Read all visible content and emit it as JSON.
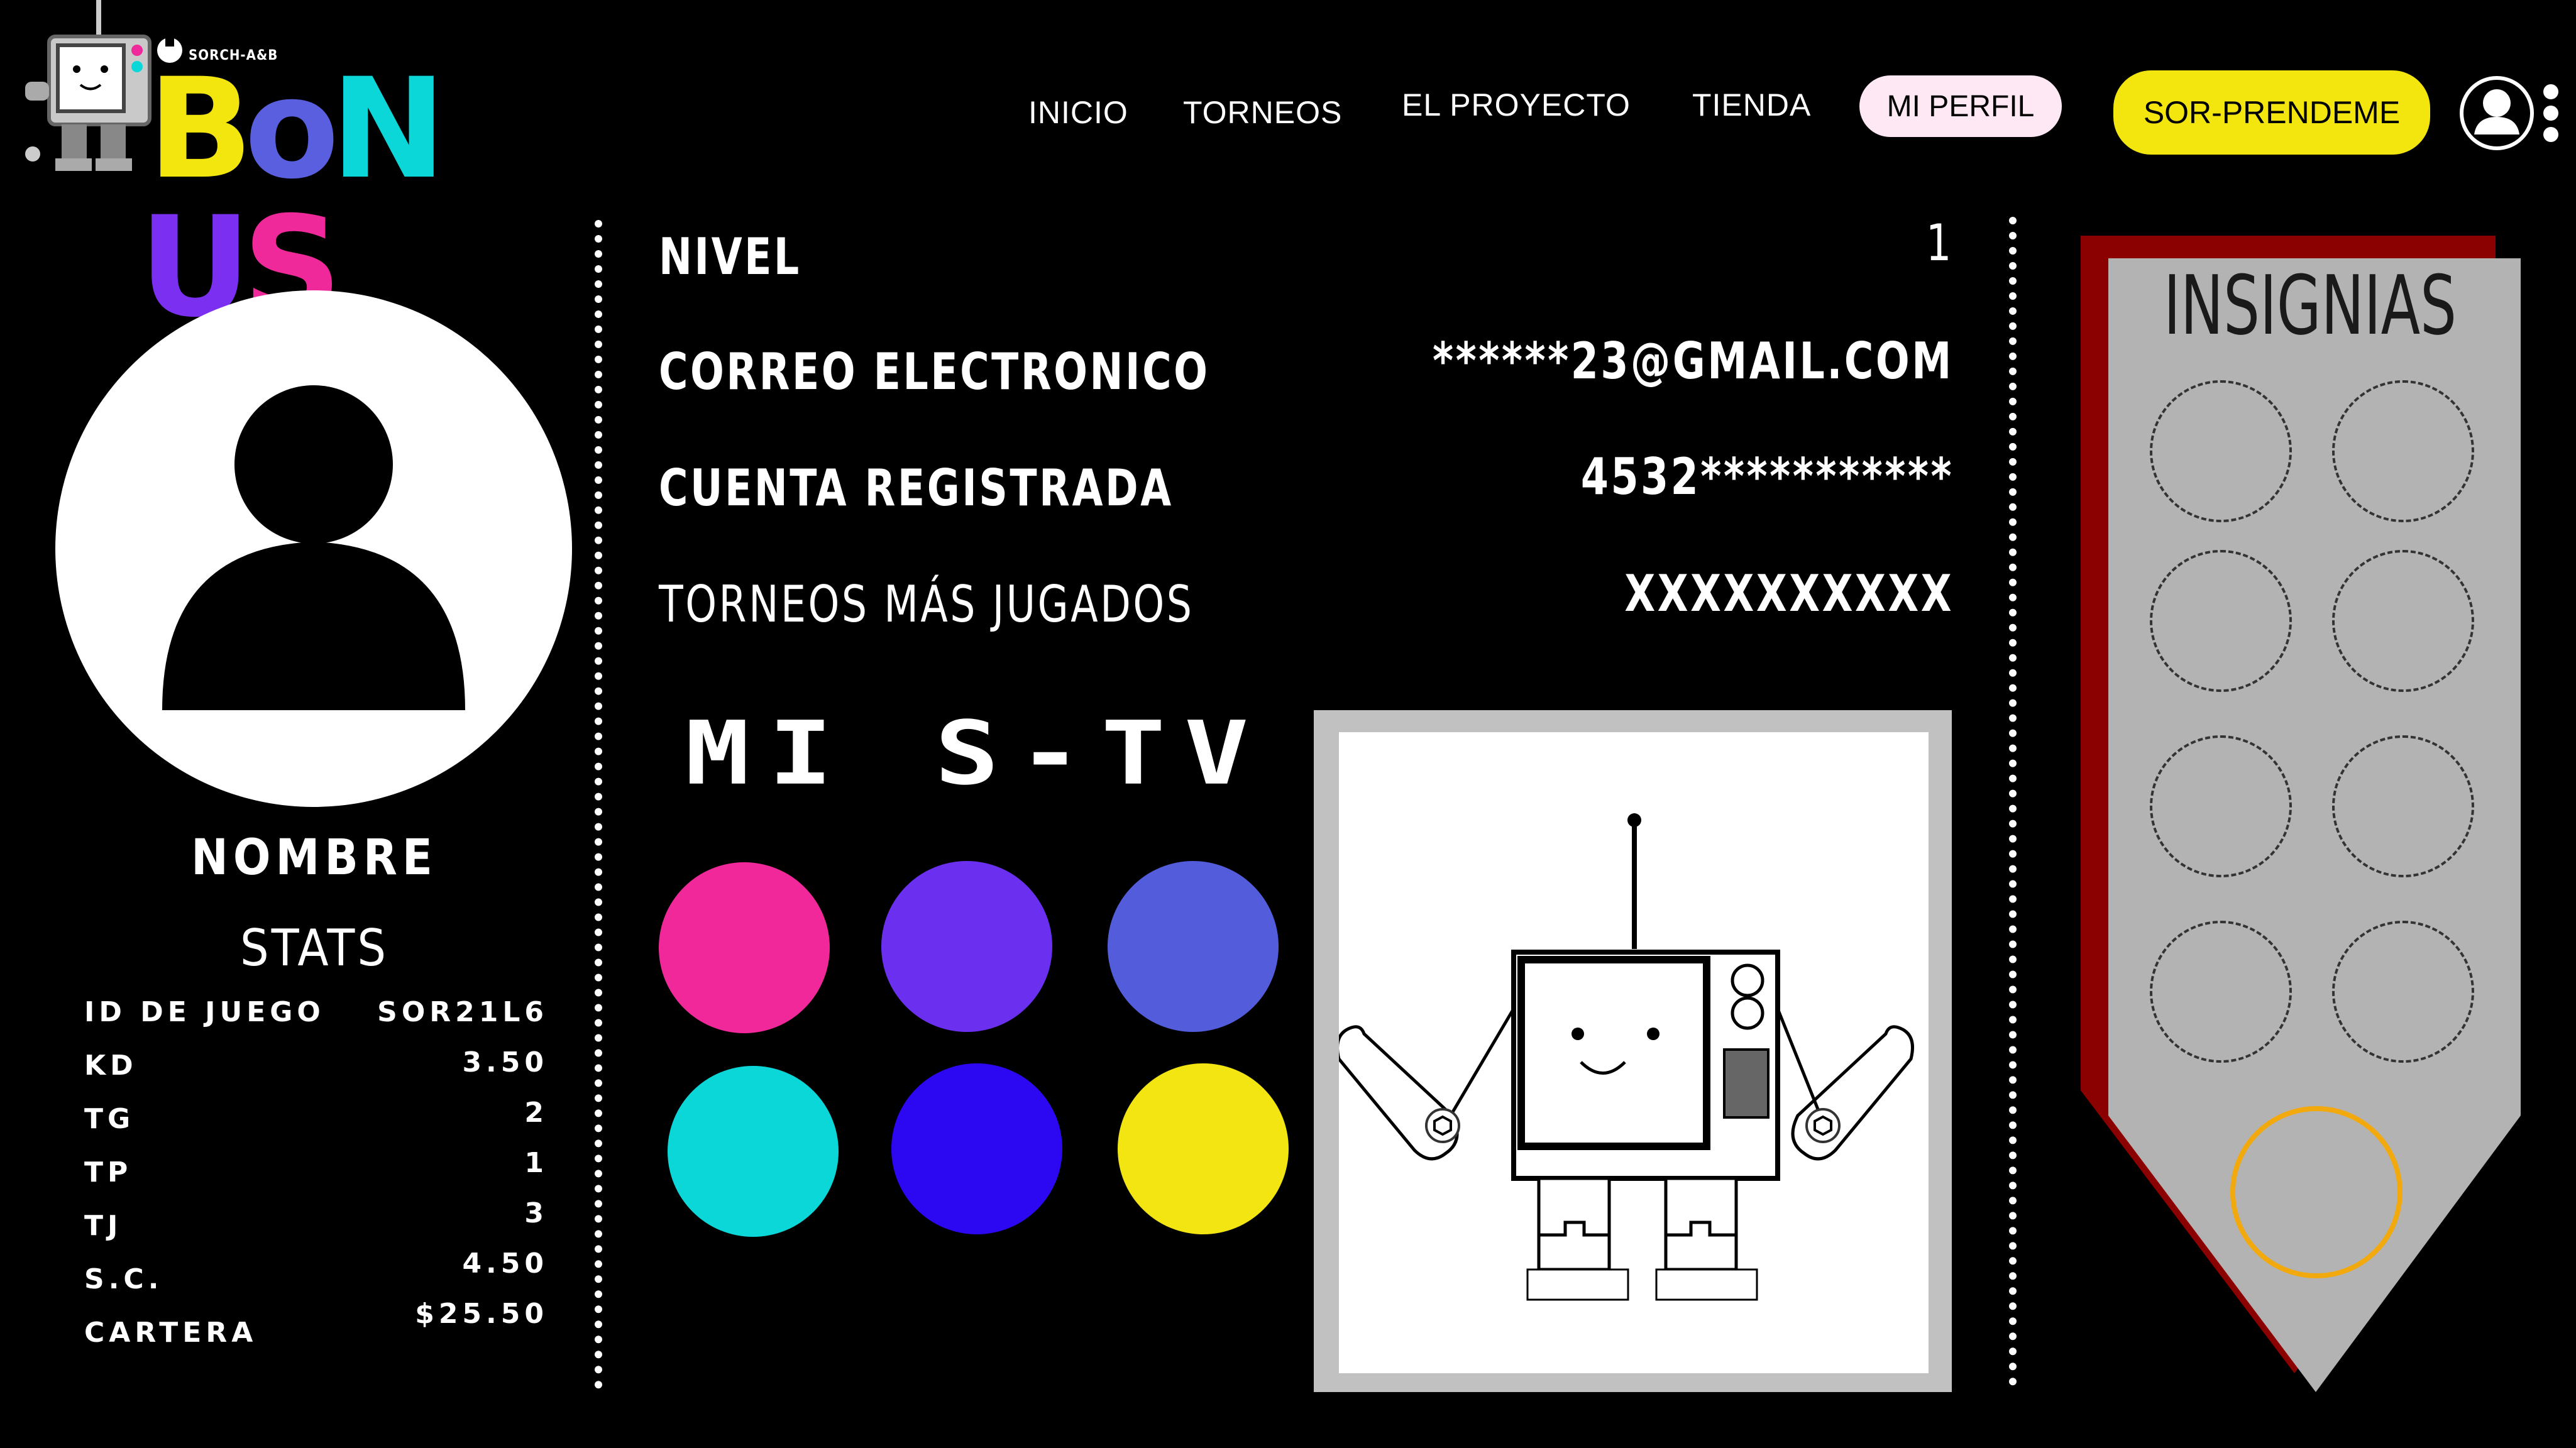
{
  "header": {
    "logo_small_text": "SORCH-A&B",
    "logo_letters": [
      {
        "char": "B",
        "color": "#f2e60e"
      },
      {
        "char": "o",
        "color": "#5a5fe0"
      },
      {
        "char": "N",
        "color": "#0bd7d8"
      },
      {
        "char": "U",
        "color": "#7b2ff0"
      },
      {
        "char": "S",
        "color": "#f0299a"
      }
    ],
    "nav": [
      "INICIO",
      "TORNEOS",
      "EL PROYECTO",
      "TIENDA"
    ],
    "active_nav": "MI PERFIL",
    "cta_button": "SOR-PRENDEME",
    "user_icon": "user-circle-icon",
    "menu_icon": "vertical-dots-icon"
  },
  "profile": {
    "avatar_icon": "user-placeholder-icon",
    "name": "NOMBRE",
    "stats_title": "STATS",
    "stats": [
      {
        "label": "ID DE JUEGO",
        "value": "SOR21L6"
      },
      {
        "label": "KD",
        "value": "3.50"
      },
      {
        "label": "TG",
        "value": "2"
      },
      {
        "label": "TP",
        "value": "1"
      },
      {
        "label": "TJ",
        "value": "3"
      },
      {
        "label": "S.C.",
        "value": "4.50"
      },
      {
        "label": "CARTERA",
        "value": "$25.50"
      }
    ]
  },
  "info": [
    {
      "label": "NIVEL",
      "value": "1"
    },
    {
      "label": "CORREO ELECTRONICO",
      "value": "******23@GMAIL.COM"
    },
    {
      "label": "CUENTA REGISTRADA",
      "value": "4532***********"
    },
    {
      "label": "TORNEOS MÁS JUGADOS",
      "value": "XXXXXXXXXX"
    }
  ],
  "stv": {
    "title": "MI S-TV",
    "colors": [
      "#f0289a",
      "#6b2ff0",
      "#535ddb",
      "#0bd7d8",
      "#2b07f2",
      "#f2e512"
    ],
    "robot_icon": "tv-robot-mascot"
  },
  "badges": {
    "title": "INSIGNIAS",
    "slots": 8,
    "highlight_color": "#f2a90e"
  }
}
